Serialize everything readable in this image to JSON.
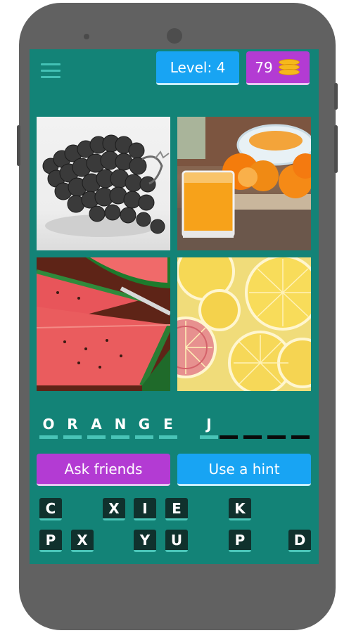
{
  "header": {
    "level_label": "Level: 4",
    "coins": "79",
    "menu_icon": "hamburger-menu-icon",
    "coin_icon": "coin-stack-icon"
  },
  "images": [
    "grapes",
    "orange-juice",
    "watermelon",
    "citrus-slices"
  ],
  "answer": {
    "letters": [
      "O",
      "R",
      "A",
      "N",
      "G",
      "E",
      "",
      "J",
      "",
      "",
      "",
      ""
    ],
    "filled_line_color": "#49c4b7",
    "empty_line_color": "#0a0a0a"
  },
  "actions": {
    "ask_friends": "Ask friends",
    "use_hint": "Use a hint"
  },
  "keyboard": {
    "row1": [
      "C",
      "",
      "X",
      "I",
      "E",
      "",
      "K",
      ""
    ],
    "row2": [
      "P",
      "X",
      "",
      "Y",
      "U",
      "",
      "P",
      "",
      "D"
    ]
  },
  "colors": {
    "screen_bg": "#138377",
    "blue_button": "#18a4f3",
    "purple_button": "#b33bd3",
    "key_bg": "#10312d",
    "phone_body": "#616161"
  }
}
